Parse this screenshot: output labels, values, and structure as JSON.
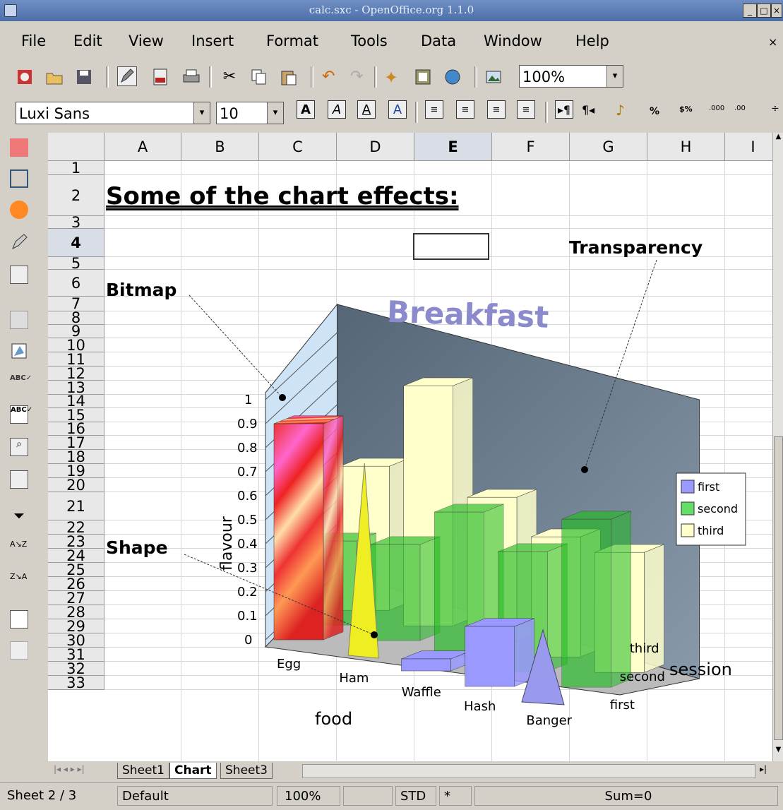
{
  "window": {
    "title": "calc.sxc - OpenOffice.org 1.1.0"
  },
  "menu": [
    "File",
    "Edit",
    "View",
    "Insert",
    "Format",
    "Tools",
    "Data",
    "Window",
    "Help"
  ],
  "toolbar": {
    "zoom": "100%"
  },
  "format_toolbar": {
    "font": "Luxi Sans",
    "size": "10"
  },
  "columns": [
    "A",
    "B",
    "C",
    "D",
    "E",
    "F",
    "G",
    "H",
    "I"
  ],
  "rows": [
    "1",
    "2",
    "3",
    "4",
    "5",
    "6",
    "7",
    "8",
    "9",
    "10",
    "11",
    "12",
    "13",
    "14",
    "15",
    "16",
    "17",
    "18",
    "19",
    "20",
    "21",
    "22",
    "23",
    "24",
    "25",
    "26",
    "27",
    "28",
    "29",
    "30",
    "31",
    "32",
    "33"
  ],
  "cells": {
    "heading": "Some of the chart effects:",
    "transparency": "Transparency",
    "bitmap": "Bitmap",
    "shape": "Shape"
  },
  "chart_data": {
    "type": "bar",
    "title": "Breakfast",
    "categories": [
      "Egg",
      "Ham",
      "Waffle",
      "Hash",
      "Banger"
    ],
    "series": [
      {
        "name": "first",
        "values": [
          0.9,
          0.8,
          0.05,
          0.25,
          0.3
        ]
      },
      {
        "name": "second",
        "values": [
          0.35,
          0.4,
          0.6,
          0.5,
          0.7
        ]
      },
      {
        "name": "third",
        "values": [
          0.6,
          1.0,
          0.6,
          0.5,
          0.5
        ]
      }
    ],
    "xlabel": "food",
    "ylabel": "flavour",
    "zlabel": "session",
    "z_categories": [
      "first",
      "second",
      "third"
    ],
    "y_ticks": [
      "0",
      "0.1",
      "0.2",
      "0.3",
      "0.4",
      "0.5",
      "0.6",
      "0.7",
      "0.8",
      "0.9",
      "1"
    ],
    "ylim": [
      0,
      1
    ],
    "legend": "right",
    "colors": {
      "first": "#9999ff",
      "second": "#66dd66",
      "third": "#ffffcc"
    }
  },
  "sheet_tabs": [
    "Sheet1",
    "Chart",
    "Sheet3"
  ],
  "active_tab": "Chart",
  "status": {
    "sheet": "Sheet 2 / 3",
    "style": "Default",
    "zoom": "100%",
    "mode": "STD",
    "modified": "*",
    "sum": "Sum=0"
  }
}
